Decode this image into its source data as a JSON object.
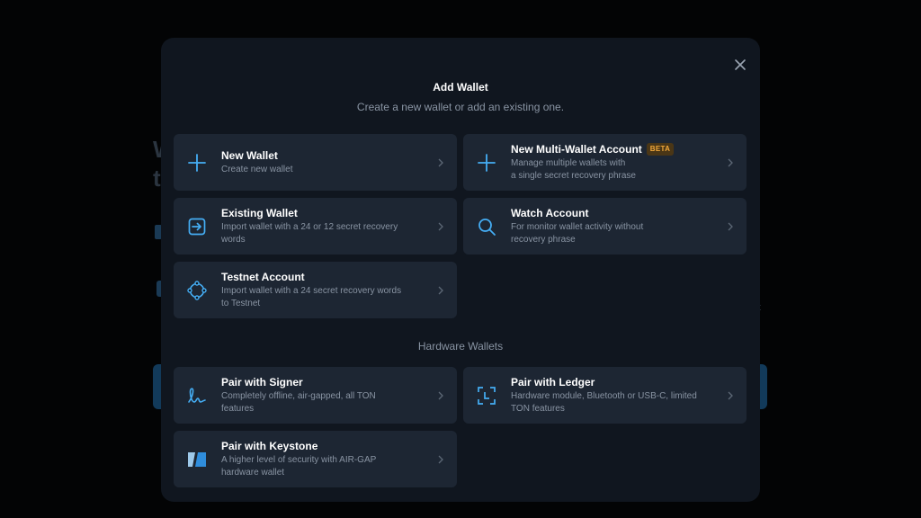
{
  "background": {
    "fragment_letters": "W\nt",
    "fragment_side": "t"
  },
  "modal": {
    "title": "Add Wallet",
    "subtitle": "Create a new wallet or add an existing one."
  },
  "options": [
    {
      "label": "New Wallet",
      "desc": "Create new wallet",
      "icon": "plus-icon"
    },
    {
      "label": "New Multi-Wallet Account",
      "badge": "BETA",
      "desc": "Manage multiple wallets with\na single secret recovery phrase",
      "icon": "plus-icon"
    },
    {
      "label": "Existing Wallet",
      "desc": "Import wallet with a 24 or 12 secret recovery\nwords",
      "icon": "import-icon"
    },
    {
      "label": "Watch Account",
      "desc": "For monitor wallet activity without\nrecovery phrase",
      "icon": "search-icon"
    },
    {
      "label": "Testnet Account",
      "desc": "Import wallet with a 24 secret recovery words\nto Testnet",
      "icon": "testnet-icon"
    }
  ],
  "hardware": {
    "heading": "Hardware Wallets",
    "options": [
      {
        "label": "Pair with Signer",
        "desc": "Completely offline, air-gapped, all TON\nfeatures",
        "icon": "signer-icon"
      },
      {
        "label": "Pair with Ledger",
        "desc": "Hardware module, Bluetooth or USB-C, limited\nTON features",
        "icon": "ledger-icon"
      },
      {
        "label": "Pair with Keystone",
        "desc": "A higher level of security with AIR-GAP\nhardware wallet",
        "icon": "keystone-icon"
      }
    ]
  },
  "colors": {
    "accent": "#45aef5",
    "card_bg": "#1d2633",
    "modal_bg": "#10161f",
    "badge_text": "#f2a83a"
  }
}
